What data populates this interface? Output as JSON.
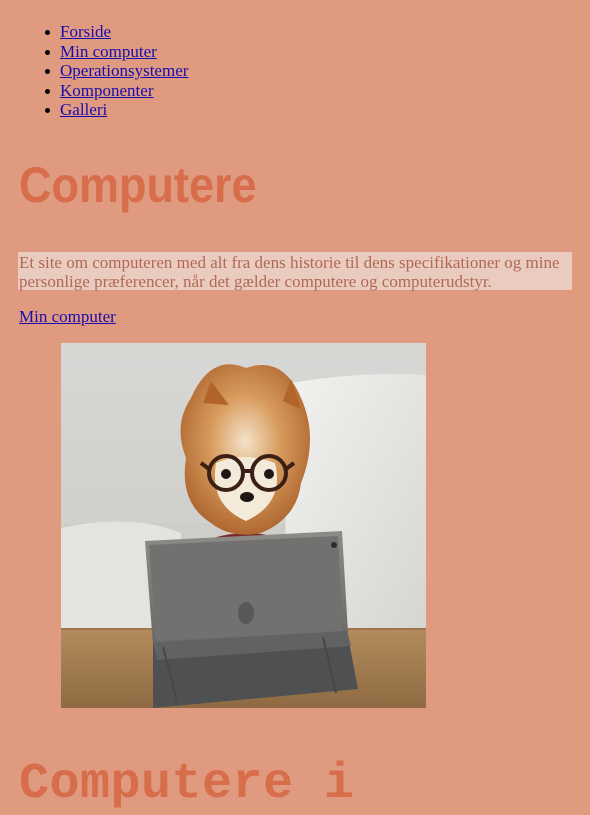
{
  "nav": {
    "items": [
      {
        "label": "Forside"
      },
      {
        "label": "Min computer"
      },
      {
        "label": "Operationsystemer"
      },
      {
        "label": "Komponenter"
      },
      {
        "label": "Galleri"
      }
    ]
  },
  "page": {
    "title": "Computere",
    "intro": "Et site om computeren med alt fra dens historie til dens specifikationer og mine personlige præferencer, når det gælder computere og computerudstyr.",
    "section_link": "Min computer",
    "subtitle": "Computere i"
  },
  "theme": {
    "background": "#df9a7f",
    "accent": "#d86d4c",
    "intro_bg": "#eacbc0",
    "intro_text": "#b26854",
    "link": "#1a0dab"
  }
}
